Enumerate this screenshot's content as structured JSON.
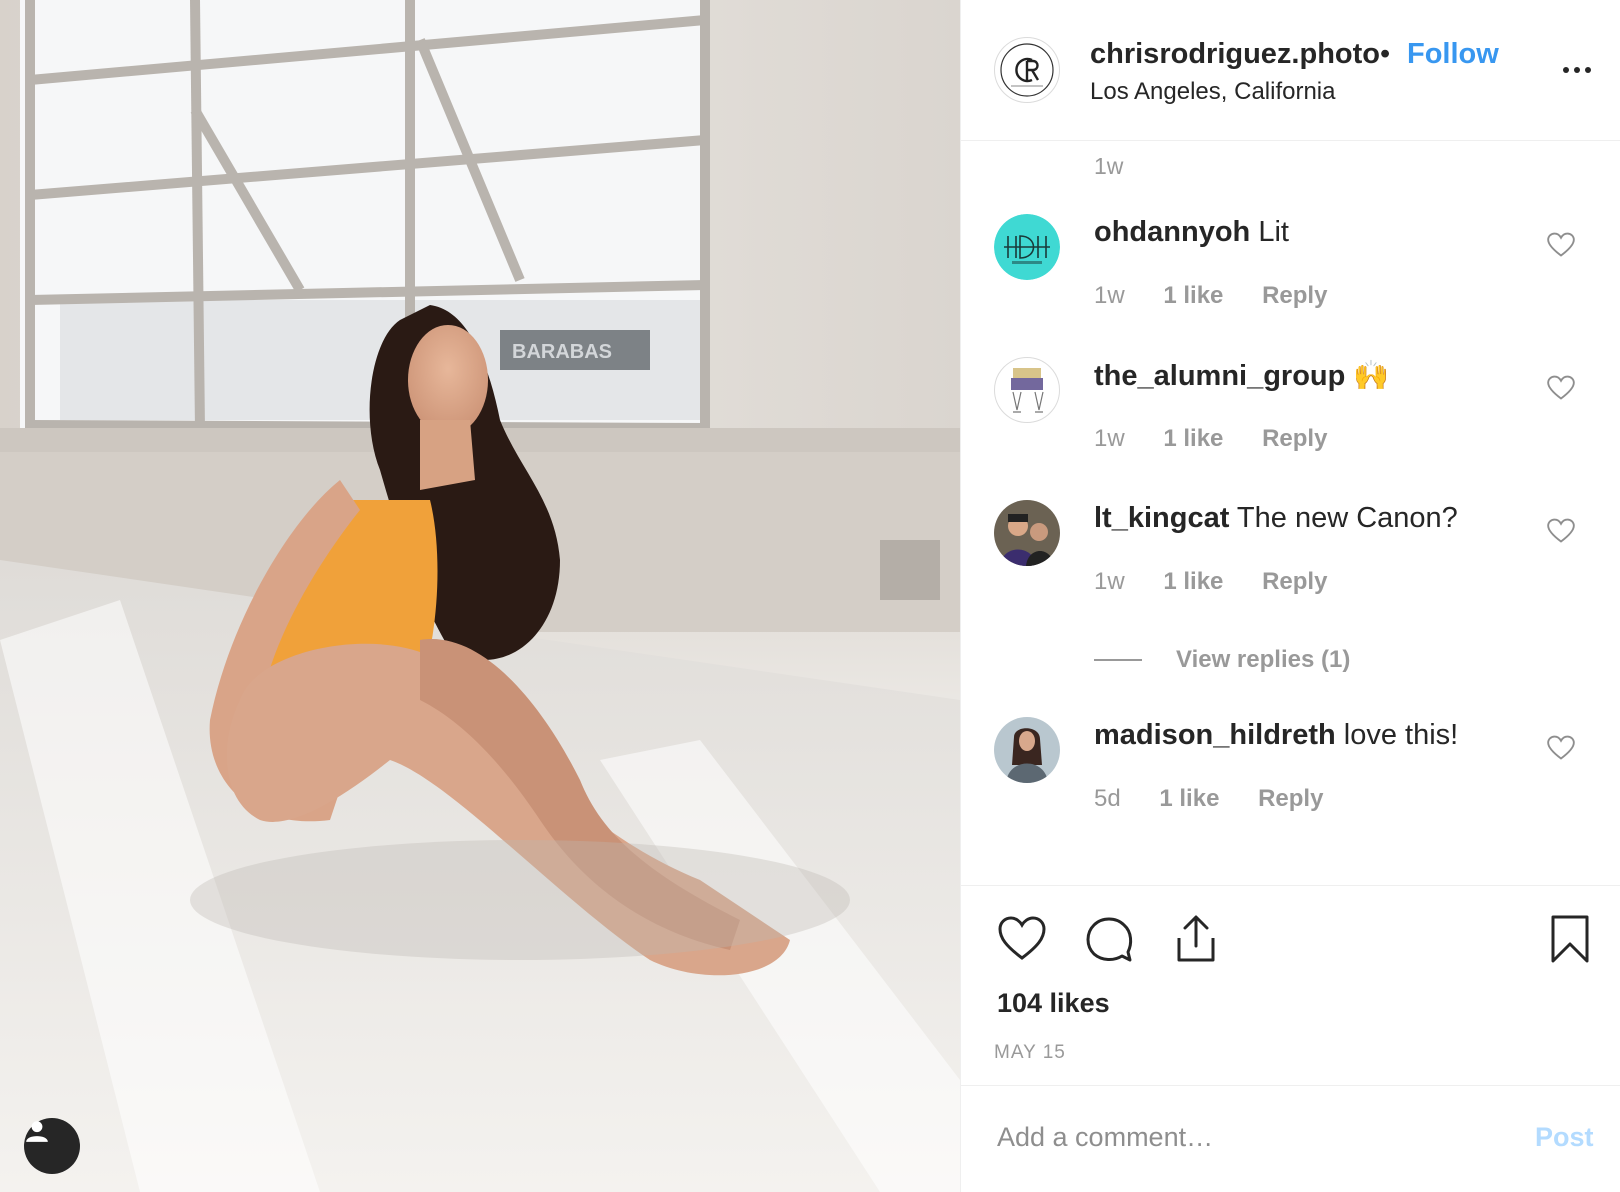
{
  "post": {
    "username": "chrisrodriguez.photo",
    "separator": "•",
    "follow_label": "Follow",
    "location": "Los Angeles, California",
    "likes_text": "104 likes",
    "date": "MAY 15",
    "photo_sign_text": "BARABAS"
  },
  "comments": {
    "top_timestamp": "1w",
    "items": [
      {
        "username": "ohdannyoh",
        "text": "Lit",
        "time": "1w",
        "likes": "1 like",
        "reply": "Reply"
      },
      {
        "username": "the_alumni_group",
        "text": "🙌",
        "time": "1w",
        "likes": "1 like",
        "reply": "Reply"
      },
      {
        "username": "lt_kingcat",
        "text": "The new Canon?",
        "time": "1w",
        "likes": "1 like",
        "reply": "Reply"
      },
      {
        "username": "madison_hildreth",
        "text": "love this!",
        "time": "5d",
        "likes": "1 like",
        "reply": "Reply"
      }
    ],
    "view_replies": "View replies (1)"
  },
  "composer": {
    "placeholder": "Add a comment…",
    "post_label": "Post"
  },
  "icons": {
    "more": "more-options-icon",
    "like": "heart-icon",
    "comment": "comment-bubble-icon",
    "share": "share-icon",
    "save": "bookmark-icon",
    "user_tag": "person-icon"
  },
  "colors": {
    "link_blue": "#3897f0",
    "post_disabled": "#b3dbff",
    "secondary_text": "#999999",
    "border": "#efefef"
  }
}
